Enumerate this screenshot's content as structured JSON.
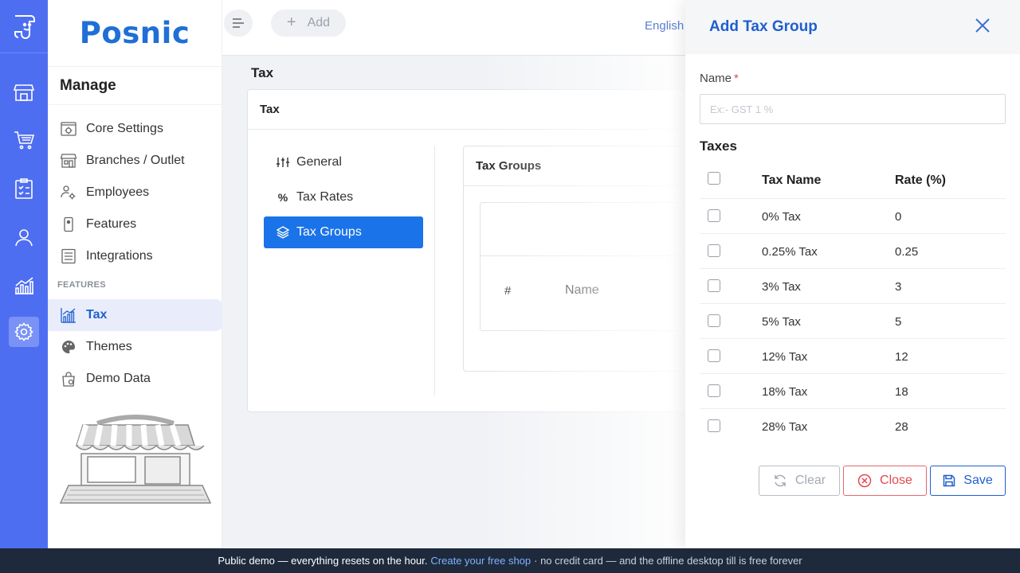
{
  "app": {
    "brand": "Posnic"
  },
  "rail": {
    "items": [
      {
        "icon": "store-icon"
      },
      {
        "icon": "cart-icon"
      },
      {
        "icon": "clipboard-icon"
      },
      {
        "icon": "user-icon"
      },
      {
        "icon": "bar-chart-icon"
      },
      {
        "icon": "gear-icon",
        "active": true
      }
    ]
  },
  "sidebar": {
    "section_title": "Manage",
    "features_label": "FEATURES",
    "items": [
      {
        "label": "Core Settings",
        "icon": "settings-screen-icon"
      },
      {
        "label": "Branches / Outlet",
        "icon": "store-icon"
      },
      {
        "label": "Employees",
        "icon": "users-gear-icon"
      },
      {
        "label": "Features",
        "icon": "phone-icon"
      },
      {
        "label": "Integrations",
        "icon": "list-icon"
      },
      {
        "label": "Tax",
        "icon": "chart-icon",
        "active": true
      },
      {
        "label": "Themes",
        "icon": "palette-icon"
      },
      {
        "label": "Demo Data",
        "icon": "bag-icon"
      }
    ]
  },
  "topbar": {
    "add_label": "Add",
    "language": "English"
  },
  "main": {
    "page_title": "Tax",
    "card_title": "Tax",
    "tabs": [
      {
        "label": "General",
        "icon": "sliders-icon"
      },
      {
        "label": "Tax Rates",
        "icon": "percent-icon"
      },
      {
        "label": "Tax Groups",
        "icon": "layers-icon",
        "active": true
      }
    ],
    "groups_card": {
      "title": "Tax Groups",
      "columns": [
        "#",
        "Name"
      ]
    }
  },
  "drawer": {
    "title": "Add Tax Group",
    "name_label": "Name",
    "required_mark": "*",
    "name_value": "",
    "name_placeholder": "Ex:- GST 1 %",
    "taxes_heading": "Taxes",
    "columns": {
      "name": "Tax Name",
      "rate": "Rate (%)"
    },
    "rows": [
      {
        "name": "0% Tax",
        "rate": "0"
      },
      {
        "name": "0.25% Tax",
        "rate": "0.25"
      },
      {
        "name": "3% Tax",
        "rate": "3"
      },
      {
        "name": "5% Tax",
        "rate": "5"
      },
      {
        "name": "12% Tax",
        "rate": "12"
      },
      {
        "name": "18% Tax",
        "rate": "18"
      },
      {
        "name": "28% Tax",
        "rate": "28"
      }
    ],
    "buttons": {
      "clear": "Clear",
      "close": "Close",
      "save": "Save"
    }
  },
  "footer": {
    "lead": "Public demo — everything resets on the hour.",
    "link": "Create your free shop",
    "tail": "· no credit card — and the offline desktop till is free forever"
  },
  "colors": {
    "rail": "#4e6ef2",
    "brand": "#1f6fd6",
    "accent": "#1a73e8",
    "danger": "#e5484d",
    "footer": "#1e2a3c"
  }
}
